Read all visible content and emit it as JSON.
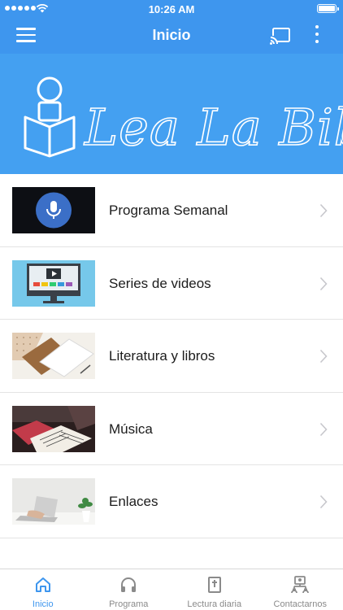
{
  "status_bar": {
    "time": "10:26 AM"
  },
  "navbar": {
    "title": "Inicio"
  },
  "banner": {
    "logo_text": "Lea La Biblia"
  },
  "list": {
    "items": [
      {
        "label": "Programa Semanal",
        "thumb_icon": "microphone-icon"
      },
      {
        "label": "Series de videos",
        "thumb_icon": "monitor-video-icon"
      },
      {
        "label": "Literatura y libros",
        "thumb_icon": "books-desk-icon"
      },
      {
        "label": "Música",
        "thumb_icon": "sheet-music-icon"
      },
      {
        "label": "Enlaces",
        "thumb_icon": "laptop-icon"
      }
    ]
  },
  "tabbar": {
    "tabs": [
      {
        "label": "Inicio",
        "icon": "home-icon",
        "active": true
      },
      {
        "label": "Programa",
        "icon": "headphones-icon",
        "active": false
      },
      {
        "label": "Lectura diaria",
        "icon": "bible-icon",
        "active": false
      },
      {
        "label": "Contactarnos",
        "icon": "contact-icon",
        "active": false
      }
    ]
  },
  "colors": {
    "accent": "#3e96ee",
    "banner": "#44a0f1",
    "tab_inactive": "#8a8a8a"
  }
}
